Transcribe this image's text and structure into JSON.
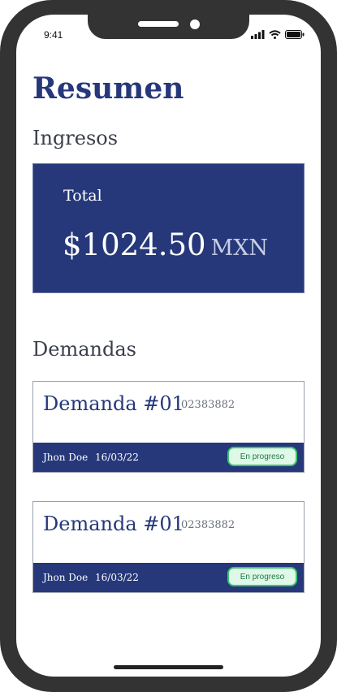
{
  "status_bar": {
    "time": "9:41"
  },
  "page": {
    "title": "Resumen",
    "income_section": "Ingresos",
    "demands_section": "Demandas"
  },
  "income": {
    "label": "Total",
    "currency_symbol": "$",
    "amount": "1024.50",
    "currency_code": "MXN"
  },
  "demands": [
    {
      "title": "Demanda #01",
      "code": "02383882",
      "user": "Jhon Doe",
      "date": "16/03/22",
      "status": "En progreso"
    },
    {
      "title": "Demanda #01",
      "code": "02383882",
      "user": "Jhon Doe",
      "date": "16/03/22",
      "status": "En progreso"
    }
  ],
  "colors": {
    "primary": "#26387a",
    "badge_bg": "#dff8e8",
    "badge_border": "#3cc46f",
    "frame": "#333333"
  },
  "icons": [
    "signal-icon",
    "wifi-icon",
    "battery-icon"
  ]
}
